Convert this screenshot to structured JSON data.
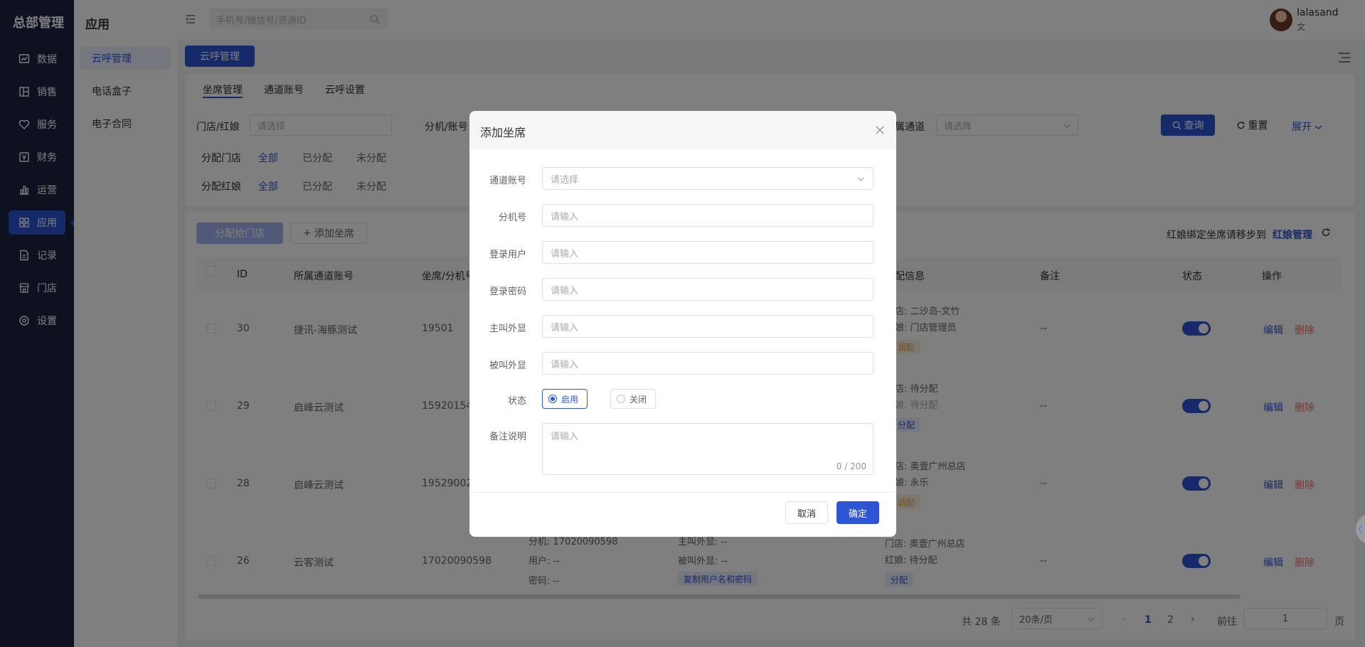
{
  "nav": {
    "brand": "总部管理",
    "items": [
      {
        "label": "数据",
        "icon": "chart-icon"
      },
      {
        "label": "销售",
        "icon": "grid-icon"
      },
      {
        "label": "服务",
        "icon": "heart-icon"
      },
      {
        "label": "财务",
        "icon": "yen-icon"
      },
      {
        "label": "运营",
        "icon": "bar-icon"
      },
      {
        "label": "应用",
        "icon": "apps-icon"
      },
      {
        "label": "记录",
        "icon": "doc-icon"
      },
      {
        "label": "门店",
        "icon": "store-icon"
      },
      {
        "label": "设置",
        "icon": "settings-icon"
      }
    ]
  },
  "subnav": {
    "title": "应用",
    "items": [
      "云呼管理",
      "电话盒子",
      "电子合同"
    ]
  },
  "topbar": {
    "search_placeholder": "手机号/微信号/资源ID",
    "user_name": "lalasand",
    "user_role": "文"
  },
  "content": {
    "main_button": "云呼管理",
    "tabs": [
      "坐席管理",
      "通道账号",
      "云呼设置"
    ],
    "filters": {
      "store_label": "门店/红娘",
      "store_placeholder": "请选择",
      "ext_label": "分机/账号",
      "channel_label": "属通道",
      "channel_placeholder": "请选择",
      "query": "查询",
      "reset": "重置",
      "expand": "展开",
      "assign_store_label": "分配门店",
      "assign_mm_label": "分配红娘",
      "opt_all": "全部",
      "opt_assigned": "已分配",
      "opt_unassigned": "未分配"
    },
    "toolbar": {
      "assign_button": "分配给门店",
      "add_button": "添加坐席",
      "notice": "红娘绑定坐席请移步到",
      "notice_link": "红娘管理"
    },
    "columns": [
      "ID",
      "所属通道账号",
      "坐席/分机号",
      "配信息",
      "备注",
      "状态",
      "操作"
    ],
    "rows": [
      {
        "id": "30",
        "channel": "捷讯-海豚测试",
        "ext": "19501",
        "store": "店: 二沙岛-文竹",
        "mm": "娘: 门店管理员",
        "tag": "调配",
        "tag_type": "orange",
        "remark": "--"
      },
      {
        "id": "29",
        "channel": "启峰云测试",
        "ext": "15920154",
        "store": "店: 待分配",
        "mm": "娘: 待分配",
        "tag": "分配",
        "tag_type": "blue",
        "remark": "--"
      },
      {
        "id": "28",
        "channel": "启峰云测试",
        "ext": "19529002",
        "store": "店: 奥壹广州总店",
        "mm": "娘: 永乐",
        "tag": "调配",
        "tag_type": "orange",
        "remark": "--"
      },
      {
        "id": "26",
        "channel": "云客测试",
        "ext": "17020090598",
        "store": "门店: 奥壹广州总店",
        "mm": "红娘: 待分配",
        "tag": "分配",
        "tag_type": "blue",
        "remark": "--"
      }
    ],
    "row26_details": {
      "ext": "分机: 17020090598",
      "user": "用户: --",
      "pwd": "密码: --",
      "main_disp": "主叫外显: --",
      "called_disp": "被叫外显: --",
      "copy": "复制用户名和密码"
    },
    "actions": {
      "edit": "编辑",
      "delete": "删除"
    },
    "pagination": {
      "total": "共 28 条",
      "page_size": "20条/页",
      "pages": [
        "1",
        "2"
      ],
      "goto_label": "前往",
      "goto_value": "1",
      "goto_suffix": "页"
    }
  },
  "modal": {
    "title": "添加坐席",
    "fields": [
      {
        "label": "通道账号",
        "placeholder": "请选择",
        "type": "select"
      },
      {
        "label": "分机号",
        "placeholder": "请输入",
        "type": "input"
      },
      {
        "label": "登录用户",
        "placeholder": "请输入",
        "type": "input"
      },
      {
        "label": "登录密码",
        "placeholder": "请输入",
        "type": "input"
      },
      {
        "label": "主叫外显",
        "placeholder": "请输入",
        "type": "input"
      },
      {
        "label": "被叫外显",
        "placeholder": "请输入",
        "type": "input"
      }
    ],
    "status_label": "状态",
    "status_on": "启用",
    "status_off": "关闭",
    "status_selected": "启用",
    "remark_label": "备注说明",
    "remark_placeholder": "请输入",
    "remark_count": "0 / 200",
    "cancel": "取消",
    "confirm": "确定"
  },
  "colors": {
    "primary": "#2c54d4",
    "nav_bg": "#1c2340",
    "danger": "#f56c6c",
    "warning": "#e6a23c"
  }
}
